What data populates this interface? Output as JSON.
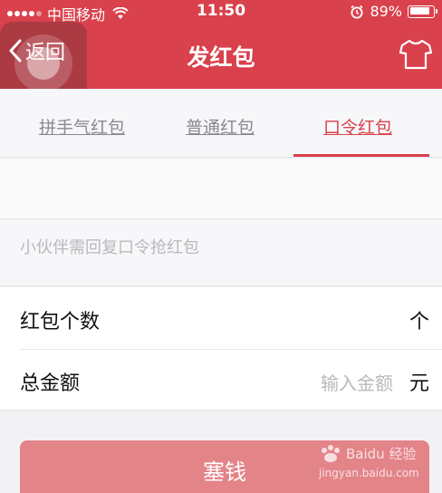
{
  "status_bar": {
    "carrier": "中国移动",
    "time": "11:50",
    "battery_percent_text": "89%",
    "battery_level": 0.89
  },
  "nav": {
    "back_label": "返回",
    "title": "发红包",
    "right_icon": "shirt-icon"
  },
  "tabs": [
    {
      "label": "拼手气红包",
      "selected": false
    },
    {
      "label": "普通红包",
      "selected": false
    },
    {
      "label": "口令红包",
      "selected": true
    }
  ],
  "password": {
    "placeholder": "小伙伴需回复口令抢红包"
  },
  "form": {
    "count_label": "红包个数",
    "count_unit": "个",
    "amount_label": "总金额",
    "amount_placeholder": "输入金额",
    "amount_unit": "元"
  },
  "submit": {
    "label": "塞钱"
  },
  "watermark": {
    "brand": "Baidu 经验",
    "url": "jingyan.baidu.com"
  },
  "colors": {
    "brand_red": "#d9414c",
    "submit_disabled": "#e38489",
    "placeholder_gray": "#b9b9bc"
  }
}
